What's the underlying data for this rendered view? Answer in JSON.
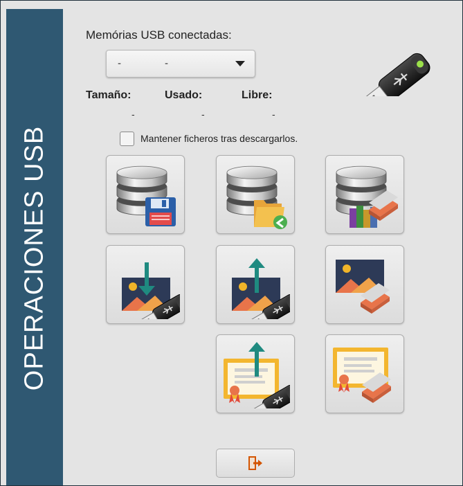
{
  "sidebar": {
    "title": "OPERACIONES USB"
  },
  "usb": {
    "label": "Memórias USB conectadas:",
    "selected_value_1": "-",
    "selected_value_2": "-"
  },
  "stats": {
    "size_label": "Tamaño:",
    "used_label": "Usado:",
    "free_label": "Libre:",
    "size_value": "-",
    "used_value": "-",
    "free_value": "-"
  },
  "options": {
    "keep_files_label": "Mantener ficheros tras descargarlos."
  },
  "actions": [
    {
      "name": "database-save-button",
      "icon": "database-floppy-icon"
    },
    {
      "name": "database-folder-import-button",
      "icon": "database-folder-arrow-icon"
    },
    {
      "name": "database-erase-button",
      "icon": "database-books-eraser-icon"
    },
    {
      "name": "image-download-usb-button",
      "icon": "image-down-arrow-usb-icon"
    },
    {
      "name": "image-upload-usb-button",
      "icon": "image-up-arrow-usb-icon"
    },
    {
      "name": "image-erase-button",
      "icon": "image-eraser-icon"
    },
    {
      "name": "certificate-upload-usb-button",
      "icon": "certificate-up-arrow-usb-icon"
    },
    {
      "name": "certificate-erase-button",
      "icon": "certificate-eraser-icon"
    }
  ],
  "exit": {
    "icon": "exit-door-icon"
  },
  "colors": {
    "sidebar": "#2f5872",
    "background": "#e4e4e4",
    "teal_arrow": "#1f8a80",
    "eraser": "#e8744a",
    "certificate": "#f3b62f"
  }
}
